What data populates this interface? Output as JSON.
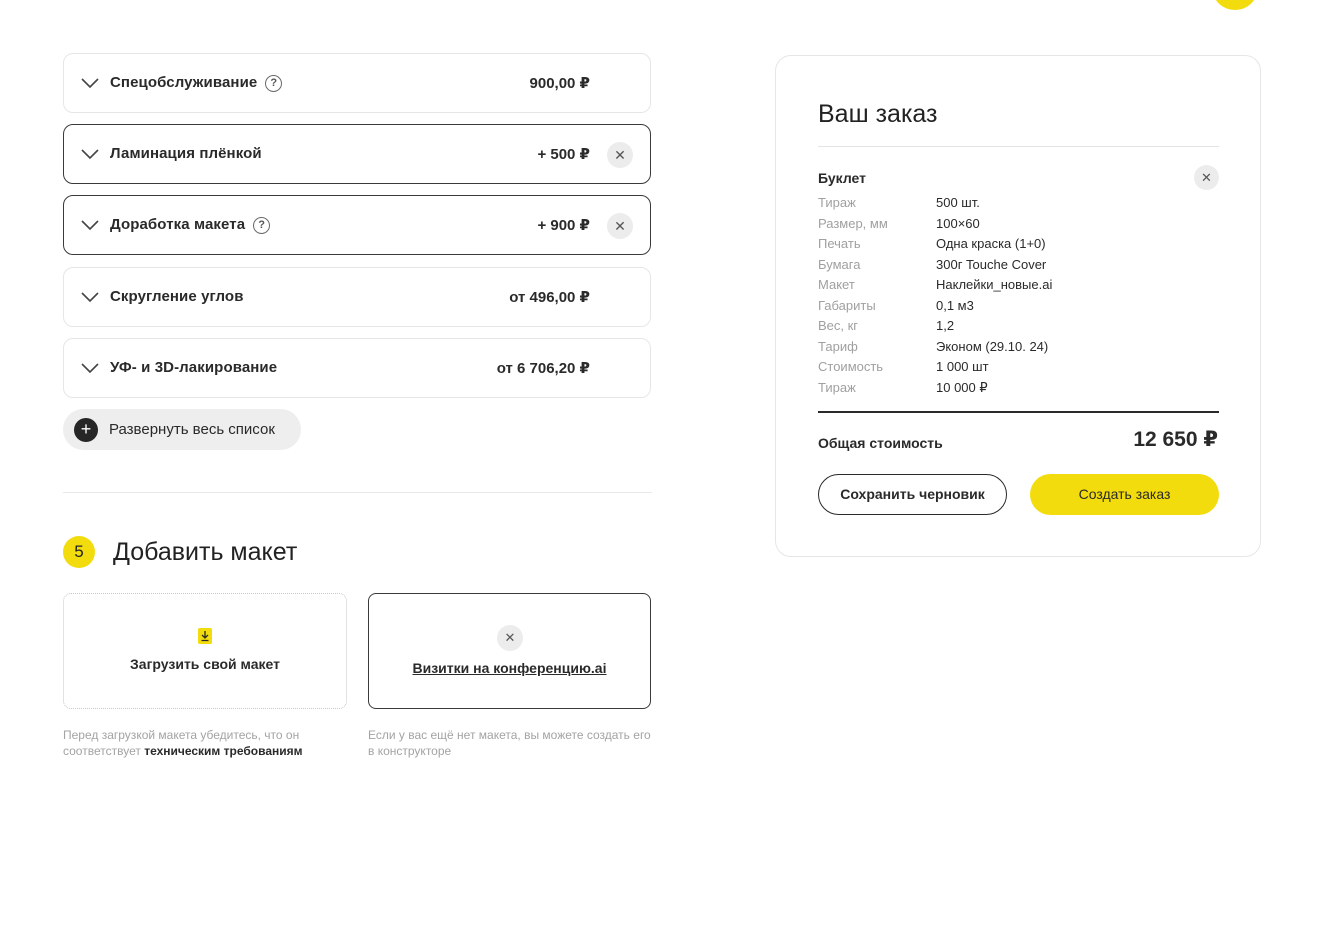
{
  "options": [
    {
      "label": "Спецобслуживание",
      "price": "900,00 ₽",
      "help": true,
      "active": false,
      "removable": false
    },
    {
      "label": "Ламинация плёнкой",
      "price": "+ 500 ₽",
      "help": false,
      "active": true,
      "removable": true
    },
    {
      "label": "Доработка макета",
      "price": "+ 900 ₽",
      "help": true,
      "active": true,
      "removable": true
    },
    {
      "label": "Скругление углов",
      "price": "от 496,00 ₽",
      "help": false,
      "active": false,
      "removable": false
    },
    {
      "label": "УФ- и 3D-лакирование",
      "price": "от 6 706,20 ₽",
      "help": false,
      "active": false,
      "removable": false
    }
  ],
  "expand_label": "Развернуть весь список",
  "step": {
    "number": "5",
    "title": "Добавить макет"
  },
  "upload": {
    "label": "Загрузить свой макет"
  },
  "file": {
    "name": "Визитки на конференцию.ai"
  },
  "notes": {
    "upload_prefix": "Перед загрузкой макета убедитесь, что он соответствует",
    "upload_link": "техническим требованиям",
    "constructor": "Если у вас ещё нет макета, вы можете создать его в конструкторе"
  },
  "order": {
    "title": "Ваш заказ",
    "product": "Буклет",
    "specs": [
      {
        "k": "Тираж",
        "v": "500 шт."
      },
      {
        "k": "Размер, мм",
        "v": "100×60"
      },
      {
        "k": "Печать",
        "v": "Одна краска (1+0)"
      },
      {
        "k": "Бумага",
        "v": "300г Touche Cover"
      },
      {
        "k": "Макет",
        "v": "Наклейки_новые.ai"
      },
      {
        "k": "Габариты",
        "v": "0,1 м3"
      },
      {
        "k": "Вес, кг",
        "v": "1,2"
      },
      {
        "k": "Тариф",
        "v": "Эконом (29.10. 24)"
      },
      {
        "k": "Стоимость",
        "v": "1 000 шт"
      },
      {
        "k": "Тираж",
        "v": "10 000 ₽"
      }
    ],
    "total_label": "Общая стоимость",
    "total_value": "12 650 ₽",
    "save_draft": "Сохранить черновик",
    "create": "Создать заказ"
  },
  "colors": {
    "accent": "#f2dc0d",
    "text": "#2a2a2a",
    "muted": "#a0a0a0"
  }
}
